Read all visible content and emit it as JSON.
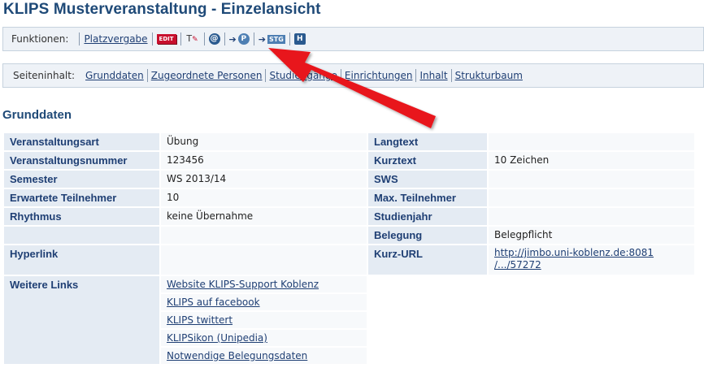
{
  "page": {
    "title": "KLIPS Musterveranstaltung - Einzelansicht"
  },
  "functions": {
    "label": "Funktionen:",
    "items": [
      {
        "type": "link",
        "label": "Platzvergabe"
      },
      {
        "type": "icon",
        "icon": "edit-icon",
        "text": "EDIT"
      },
      {
        "type": "icon",
        "icon": "text-edit-icon",
        "text": "T"
      },
      {
        "type": "icon",
        "icon": "at-icon",
        "text": "@"
      },
      {
        "type": "icon",
        "icon": "arrow-p-icon",
        "text": "P"
      },
      {
        "type": "icon",
        "icon": "arrow-stg-icon",
        "text": "STG"
      },
      {
        "type": "icon",
        "icon": "h-icon",
        "text": "H"
      }
    ]
  },
  "nav": {
    "label": "Seiteninhalt:",
    "tabs": [
      "Grunddaten",
      "Zugeordnete Personen",
      "Studiengänge",
      "Einrichtungen",
      "Inhalt",
      "Strukturbaum"
    ]
  },
  "section": {
    "title": "Grunddaten"
  },
  "grunddaten": {
    "rows": [
      {
        "k1": "Veranstaltungsart",
        "v1": "Übung",
        "k2": "Langtext",
        "v2": ""
      },
      {
        "k1": "Veranstaltungsnummer",
        "v1": "123456",
        "k2": "Kurztext",
        "v2": "10 Zeichen"
      },
      {
        "k1": "Semester",
        "v1": "WS 2013/14",
        "k2": "SWS",
        "v2": ""
      },
      {
        "k1": "Erwartete Teilnehmer",
        "v1": "10",
        "k2": "Max. Teilnehmer",
        "v2": ""
      },
      {
        "k1": "Rhythmus",
        "v1": "keine Übernahme",
        "k2": "Studienjahr",
        "v2": ""
      },
      {
        "k1": "",
        "v1": "",
        "k2": "Belegung",
        "v2": "Belegpflicht"
      }
    ],
    "hyperlink": {
      "key": "Hyperlink",
      "value": "",
      "kurzurl_key": "Kurz-URL",
      "kurzurl_line1": "http://jimbo.uni-koblenz.de:8081",
      "kurzurl_line2": "/.../57272"
    },
    "weitere_links": {
      "key": "Weitere Links",
      "links": [
        "Website KLIPS-Support Koblenz",
        "KLIPS auf facebook",
        "KLIPS twittert",
        "KLIPSikon (Unipedia)",
        "Notwendige Belegungsdaten"
      ]
    }
  },
  "annotation": {
    "arrow_color": "#e8131b"
  }
}
